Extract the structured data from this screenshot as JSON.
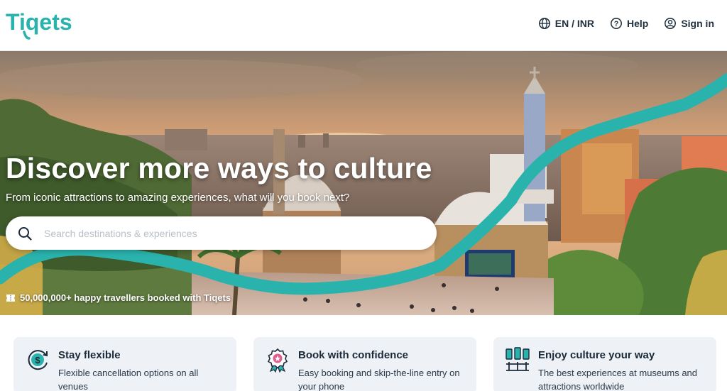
{
  "brand": {
    "logo_text": "Tiqets",
    "accent": "#2ab2ad",
    "dark": "#1b2a3a"
  },
  "nav": {
    "language_currency": "EN / INR",
    "help": "Help",
    "sign_in": "Sign in"
  },
  "hero": {
    "title": "Discover more ways to culture",
    "subtitle": "From iconic attractions to amazing experiences, what will you book next?",
    "search_placeholder": "Search destinations & experiences",
    "travellers_text": "50,000,000+ happy travellers booked with Tiqets"
  },
  "features": [
    {
      "icon": "refund-dollar-icon",
      "title": "Stay flexible",
      "text": "Flexible cancellation options on all venues"
    },
    {
      "icon": "rosette-badge-icon",
      "title": "Book with confidence",
      "text": "Easy booking and skip-the-line entry on your phone"
    },
    {
      "icon": "museum-exhibit-icon",
      "title": "Enjoy culture your way",
      "text": "The best experiences at museums and attractions worldwide"
    }
  ]
}
